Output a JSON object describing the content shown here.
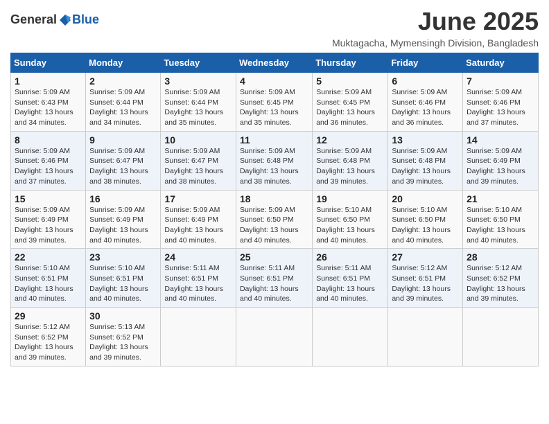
{
  "header": {
    "logo_general": "General",
    "logo_blue": "Blue",
    "title": "June 2025",
    "subtitle": "Muktagacha, Mymensingh Division, Bangladesh"
  },
  "weekdays": [
    "Sunday",
    "Monday",
    "Tuesday",
    "Wednesday",
    "Thursday",
    "Friday",
    "Saturday"
  ],
  "weeks": [
    [
      {
        "day": "1",
        "sunrise": "Sunrise: 5:09 AM",
        "sunset": "Sunset: 6:43 PM",
        "daylight": "Daylight: 13 hours and 34 minutes."
      },
      {
        "day": "2",
        "sunrise": "Sunrise: 5:09 AM",
        "sunset": "Sunset: 6:44 PM",
        "daylight": "Daylight: 13 hours and 34 minutes."
      },
      {
        "day": "3",
        "sunrise": "Sunrise: 5:09 AM",
        "sunset": "Sunset: 6:44 PM",
        "daylight": "Daylight: 13 hours and 35 minutes."
      },
      {
        "day": "4",
        "sunrise": "Sunrise: 5:09 AM",
        "sunset": "Sunset: 6:45 PM",
        "daylight": "Daylight: 13 hours and 35 minutes."
      },
      {
        "day": "5",
        "sunrise": "Sunrise: 5:09 AM",
        "sunset": "Sunset: 6:45 PM",
        "daylight": "Daylight: 13 hours and 36 minutes."
      },
      {
        "day": "6",
        "sunrise": "Sunrise: 5:09 AM",
        "sunset": "Sunset: 6:46 PM",
        "daylight": "Daylight: 13 hours and 36 minutes."
      },
      {
        "day": "7",
        "sunrise": "Sunrise: 5:09 AM",
        "sunset": "Sunset: 6:46 PM",
        "daylight": "Daylight: 13 hours and 37 minutes."
      }
    ],
    [
      {
        "day": "8",
        "sunrise": "Sunrise: 5:09 AM",
        "sunset": "Sunset: 6:46 PM",
        "daylight": "Daylight: 13 hours and 37 minutes."
      },
      {
        "day": "9",
        "sunrise": "Sunrise: 5:09 AM",
        "sunset": "Sunset: 6:47 PM",
        "daylight": "Daylight: 13 hours and 38 minutes."
      },
      {
        "day": "10",
        "sunrise": "Sunrise: 5:09 AM",
        "sunset": "Sunset: 6:47 PM",
        "daylight": "Daylight: 13 hours and 38 minutes."
      },
      {
        "day": "11",
        "sunrise": "Sunrise: 5:09 AM",
        "sunset": "Sunset: 6:48 PM",
        "daylight": "Daylight: 13 hours and 38 minutes."
      },
      {
        "day": "12",
        "sunrise": "Sunrise: 5:09 AM",
        "sunset": "Sunset: 6:48 PM",
        "daylight": "Daylight: 13 hours and 39 minutes."
      },
      {
        "day": "13",
        "sunrise": "Sunrise: 5:09 AM",
        "sunset": "Sunset: 6:48 PM",
        "daylight": "Daylight: 13 hours and 39 minutes."
      },
      {
        "day": "14",
        "sunrise": "Sunrise: 5:09 AM",
        "sunset": "Sunset: 6:49 PM",
        "daylight": "Daylight: 13 hours and 39 minutes."
      }
    ],
    [
      {
        "day": "15",
        "sunrise": "Sunrise: 5:09 AM",
        "sunset": "Sunset: 6:49 PM",
        "daylight": "Daylight: 13 hours and 39 minutes."
      },
      {
        "day": "16",
        "sunrise": "Sunrise: 5:09 AM",
        "sunset": "Sunset: 6:49 PM",
        "daylight": "Daylight: 13 hours and 40 minutes."
      },
      {
        "day": "17",
        "sunrise": "Sunrise: 5:09 AM",
        "sunset": "Sunset: 6:49 PM",
        "daylight": "Daylight: 13 hours and 40 minutes."
      },
      {
        "day": "18",
        "sunrise": "Sunrise: 5:09 AM",
        "sunset": "Sunset: 6:50 PM",
        "daylight": "Daylight: 13 hours and 40 minutes."
      },
      {
        "day": "19",
        "sunrise": "Sunrise: 5:10 AM",
        "sunset": "Sunset: 6:50 PM",
        "daylight": "Daylight: 13 hours and 40 minutes."
      },
      {
        "day": "20",
        "sunrise": "Sunrise: 5:10 AM",
        "sunset": "Sunset: 6:50 PM",
        "daylight": "Daylight: 13 hours and 40 minutes."
      },
      {
        "day": "21",
        "sunrise": "Sunrise: 5:10 AM",
        "sunset": "Sunset: 6:50 PM",
        "daylight": "Daylight: 13 hours and 40 minutes."
      }
    ],
    [
      {
        "day": "22",
        "sunrise": "Sunrise: 5:10 AM",
        "sunset": "Sunset: 6:51 PM",
        "daylight": "Daylight: 13 hours and 40 minutes."
      },
      {
        "day": "23",
        "sunrise": "Sunrise: 5:10 AM",
        "sunset": "Sunset: 6:51 PM",
        "daylight": "Daylight: 13 hours and 40 minutes."
      },
      {
        "day": "24",
        "sunrise": "Sunrise: 5:11 AM",
        "sunset": "Sunset: 6:51 PM",
        "daylight": "Daylight: 13 hours and 40 minutes."
      },
      {
        "day": "25",
        "sunrise": "Sunrise: 5:11 AM",
        "sunset": "Sunset: 6:51 PM",
        "daylight": "Daylight: 13 hours and 40 minutes."
      },
      {
        "day": "26",
        "sunrise": "Sunrise: 5:11 AM",
        "sunset": "Sunset: 6:51 PM",
        "daylight": "Daylight: 13 hours and 40 minutes."
      },
      {
        "day": "27",
        "sunrise": "Sunrise: 5:12 AM",
        "sunset": "Sunset: 6:51 PM",
        "daylight": "Daylight: 13 hours and 39 minutes."
      },
      {
        "day": "28",
        "sunrise": "Sunrise: 5:12 AM",
        "sunset": "Sunset: 6:52 PM",
        "daylight": "Daylight: 13 hours and 39 minutes."
      }
    ],
    [
      {
        "day": "29",
        "sunrise": "Sunrise: 5:12 AM",
        "sunset": "Sunset: 6:52 PM",
        "daylight": "Daylight: 13 hours and 39 minutes."
      },
      {
        "day": "30",
        "sunrise": "Sunrise: 5:13 AM",
        "sunset": "Sunset: 6:52 PM",
        "daylight": "Daylight: 13 hours and 39 minutes."
      },
      null,
      null,
      null,
      null,
      null
    ]
  ]
}
